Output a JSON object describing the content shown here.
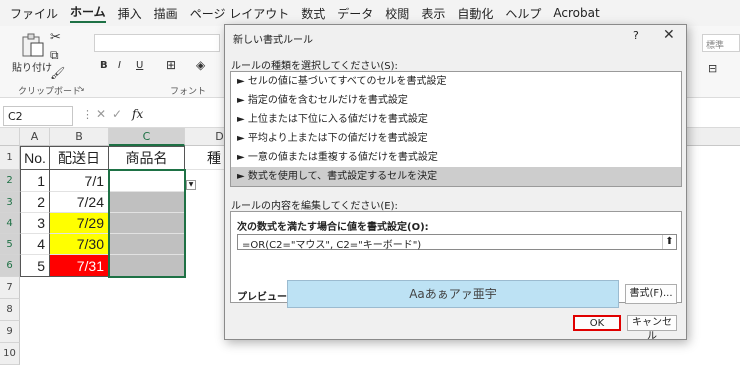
{
  "tabs": [
    "ファイル",
    "ホーム",
    "挿入",
    "描画",
    "ページ レイアウト",
    "数式",
    "データ",
    "校閲",
    "表示",
    "自動化",
    "ヘルプ",
    "Acrobat"
  ],
  "ribbon": {
    "paste": "貼り付け",
    "clipboard": "クリップボード",
    "font": "フォント",
    "style": "標準",
    "b": "B",
    "i": "I",
    "u": "U"
  },
  "formula_bar": {
    "name_box": "C2",
    "fx": "fx"
  },
  "columns": [
    "A",
    "B",
    "C",
    "D"
  ],
  "rows": [
    "1",
    "2",
    "3",
    "4",
    "5",
    "6",
    "7",
    "8",
    "9",
    "10"
  ],
  "table": {
    "headers": [
      "No.",
      "配送日",
      "商品名",
      "種"
    ],
    "rows": [
      {
        "no": "1",
        "date": "7/1"
      },
      {
        "no": "2",
        "date": "7/24"
      },
      {
        "no": "3",
        "date": "7/29"
      },
      {
        "no": "4",
        "date": "7/30"
      },
      {
        "no": "5",
        "date": "7/31"
      }
    ]
  },
  "colors": {
    "yellow": "#ffff00",
    "red": "#ff0000",
    "gray": "#c0c0c0",
    "excel_green": "#1e7145",
    "preview": "#bde2f4"
  },
  "dialog": {
    "title": "新しい書式ルール",
    "help": "?",
    "close": "✕",
    "rule_type_label": "ルールの種類を選択してください(S):",
    "rule_types": [
      "► セルの値に基づいてすべてのセルを書式設定",
      "► 指定の値を含むセルだけを書式設定",
      "► 上位または下位に入る値だけを書式設定",
      "► 平均より上または下の値だけを書式設定",
      "► 一意の値または重複する値だけを書式設定",
      "► 数式を使用して、書式設定するセルを決定"
    ],
    "edit_label": "ルールの内容を編集してください(E):",
    "formula_label": "次の数式を満たす場合に値を書式設定(O):",
    "formula": "=OR(C2=\"マウス\", C2=\"キーボード\")",
    "preview_label": "プレビュー:",
    "preview_text": "Aaあぁアァ亜宇",
    "format_button": "書式(F)...",
    "ok": "OK",
    "cancel": "キャンセル"
  }
}
